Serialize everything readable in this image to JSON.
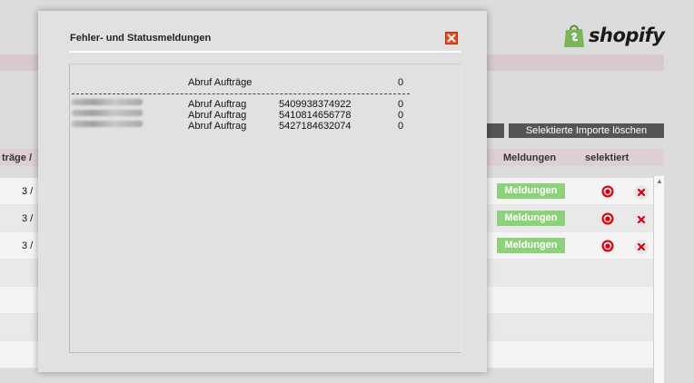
{
  "brand": {
    "name": "shopify",
    "bag_color": "#7ab55c"
  },
  "toolbar": {
    "delete_selected_label": "Selektierte Importe löschen"
  },
  "table": {
    "headers": {
      "orders": "träge  /",
      "messages": "Meldungen",
      "selected": "selektiert"
    },
    "rows": [
      {
        "num": "3  /",
        "messages_button": "Meldungen"
      },
      {
        "num": "3  /",
        "messages_button": "Meldungen"
      },
      {
        "num": "3  /",
        "messages_button": "Meldungen"
      }
    ]
  },
  "modal": {
    "title": "Fehler- und Statusmeldungen",
    "summary": {
      "label": "Abruf Aufträge",
      "count": "0"
    },
    "entries": [
      {
        "type": "Abruf Auftrag",
        "id": "5409938374922",
        "count": "0"
      },
      {
        "type": "Abruf Auftrag",
        "id": "5410814656778",
        "count": "0"
      },
      {
        "type": "Abruf Auftrag",
        "id": "5427184632074",
        "count": "0"
      }
    ]
  },
  "colors": {
    "button_green": "#8dd17a",
    "close_red": "#e84b20",
    "header_pink": "#ddcfd3"
  }
}
